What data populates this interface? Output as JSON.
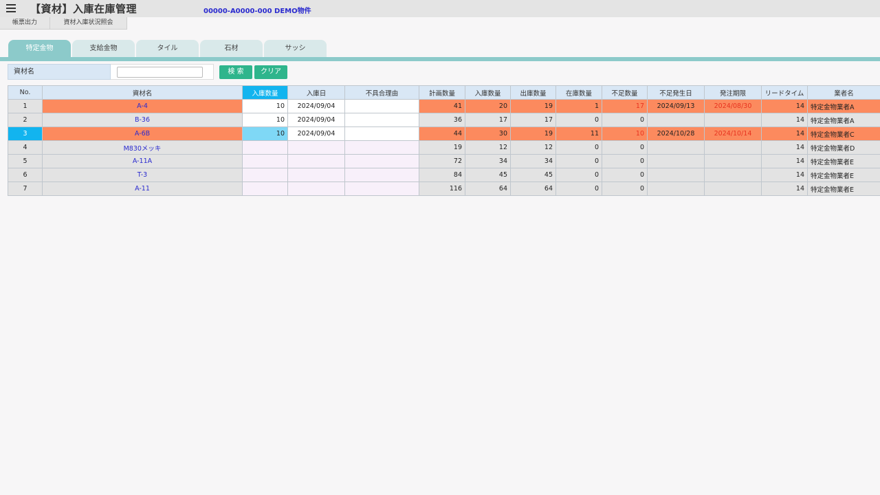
{
  "header": {
    "title": "【資材】入庫在庫管理",
    "project": "00000-A0000-000 DEMO物件",
    "menu_icon": "hamburger-menu-icon"
  },
  "subnav": [
    "帳票出力",
    "資材入庫状況照会"
  ],
  "tabs": [
    {
      "label": "特定金物",
      "active": true
    },
    {
      "label": "支給金物",
      "active": false
    },
    {
      "label": "タイル",
      "active": false
    },
    {
      "label": "石材",
      "active": false
    },
    {
      "label": "サッシ",
      "active": false
    }
  ],
  "search": {
    "label": "資材名",
    "value": "",
    "search_button": "検 索",
    "clear_button": "クリア"
  },
  "table": {
    "columns": [
      "No.",
      "資材名",
      "入庫数量",
      "入庫日",
      "不具合理由",
      "計画数量",
      "入庫数量",
      "出庫数量",
      "在庫数量",
      "不足数量",
      "不足発生日",
      "発注期限",
      "リードタイム",
      "業者名"
    ],
    "rows": [
      {
        "no": "1",
        "name": "A-4",
        "in_qty": "10",
        "in_date": "2024/09/04",
        "defect": "",
        "plan": "41",
        "received": "20",
        "shipped": "19",
        "stock": "1",
        "short": "17",
        "short_date": "2024/09/13",
        "deadline": "2024/08/30",
        "lead": "14",
        "vendor": "特定金物業者A",
        "alert": true,
        "selected": false
      },
      {
        "no": "2",
        "name": "B-36",
        "in_qty": "10",
        "in_date": "2024/09/04",
        "defect": "",
        "plan": "36",
        "received": "17",
        "shipped": "17",
        "stock": "0",
        "short": "0",
        "short_date": "",
        "deadline": "",
        "lead": "14",
        "vendor": "特定金物業者A",
        "alert": false,
        "selected": false
      },
      {
        "no": "3",
        "name": "A-6B",
        "in_qty": "10",
        "in_date": "2024/09/04",
        "defect": "",
        "plan": "44",
        "received": "30",
        "shipped": "19",
        "stock": "11",
        "short": "10",
        "short_date": "2024/10/28",
        "deadline": "2024/10/14",
        "lead": "14",
        "vendor": "特定金物業者C",
        "alert": true,
        "selected": true
      },
      {
        "no": "4",
        "name": "M830メッキ",
        "in_qty": "",
        "in_date": "",
        "defect": "",
        "plan": "19",
        "received": "12",
        "shipped": "12",
        "stock": "0",
        "short": "0",
        "short_date": "",
        "deadline": "",
        "lead": "14",
        "vendor": "特定金物業者D",
        "alert": false,
        "selected": false
      },
      {
        "no": "5",
        "name": "A-11A",
        "in_qty": "",
        "in_date": "",
        "defect": "",
        "plan": "72",
        "received": "34",
        "shipped": "34",
        "stock": "0",
        "short": "0",
        "short_date": "",
        "deadline": "",
        "lead": "14",
        "vendor": "特定金物業者E",
        "alert": false,
        "selected": false
      },
      {
        "no": "6",
        "name": "T-3",
        "in_qty": "",
        "in_date": "",
        "defect": "",
        "plan": "84",
        "received": "45",
        "shipped": "45",
        "stock": "0",
        "short": "0",
        "short_date": "",
        "deadline": "",
        "lead": "14",
        "vendor": "特定金物業者E",
        "alert": false,
        "selected": false
      },
      {
        "no": "7",
        "name": "A-11",
        "in_qty": "",
        "in_date": "",
        "defect": "",
        "plan": "116",
        "received": "64",
        "shipped": "64",
        "stock": "0",
        "short": "0",
        "short_date": "",
        "deadline": "",
        "lead": "14",
        "vendor": "特定金物業者E",
        "alert": false,
        "selected": false
      }
    ]
  },
  "colors": {
    "accent_teal": "#8ccaca",
    "button_green": "#2fb58c",
    "alert_orange": "#fc8a5e",
    "selected_blue": "#12b4ef",
    "link_blue": "#2a2acf",
    "alert_red_text": "#e8331f"
  }
}
